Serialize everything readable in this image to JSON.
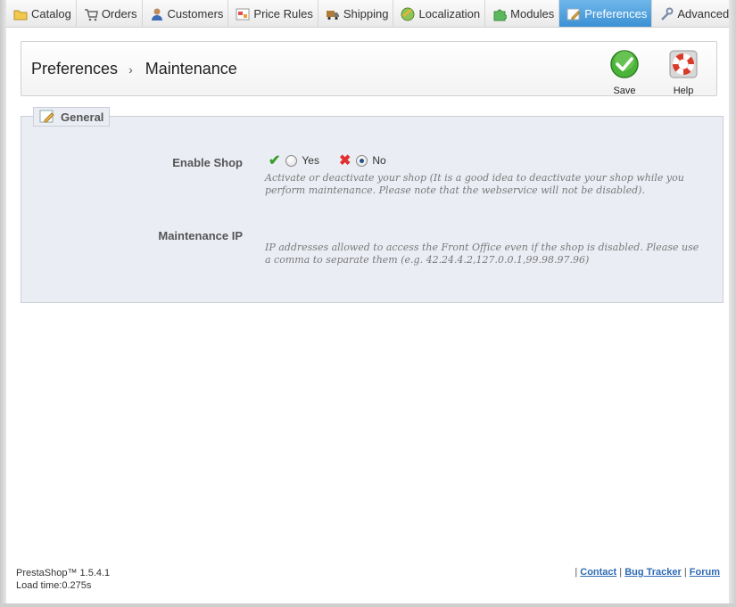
{
  "nav": {
    "tabs": [
      {
        "label": "Catalog",
        "icon": "folder-icon"
      },
      {
        "label": "Orders",
        "icon": "cart-icon"
      },
      {
        "label": "Customers",
        "icon": "user-icon"
      },
      {
        "label": "Price Rules",
        "icon": "price-tag-icon"
      },
      {
        "label": "Shipping",
        "icon": "truck-icon"
      },
      {
        "label": "Localization",
        "icon": "globe-icon"
      },
      {
        "label": "Modules",
        "icon": "puzzle-icon"
      },
      {
        "label": "Preferences",
        "icon": "preferences-icon",
        "active": true
      },
      {
        "label": "Advanced Paramete",
        "icon": "wrench-icon"
      }
    ]
  },
  "header": {
    "breadcrumb_parent": "Preferences",
    "breadcrumb_separator": "›",
    "breadcrumb_current": "Maintenance",
    "save_label": "Save",
    "help_label": "Help"
  },
  "form": {
    "legend": "General",
    "enable_shop": {
      "label": "Enable Shop",
      "yes_label": "Yes",
      "no_label": "No",
      "selected": "No",
      "hint": "Activate or deactivate your shop (It is a good idea to deactivate your shop while you perform maintenance. Please note that the webservice will not be disabled)."
    },
    "maintenance_ip": {
      "label": "Maintenance IP",
      "hint": "IP addresses allowed to access the Front Office even if the shop is disabled. Please use a comma to separate them (e.g. 42.24.4.2,127.0.0.1,99.98.97.96)"
    }
  },
  "footer": {
    "version": "PrestaShop™ 1.5.4.1",
    "load_time": "Load time:0.275s",
    "sep": "|",
    "links": {
      "contact": "Contact",
      "bug_tracker": "Bug Tracker",
      "forum": "Forum"
    }
  },
  "colors": {
    "active_tab": "#3a8fd2",
    "panel_bg": "#ebedf4",
    "link": "#2e6bb4",
    "save_green": "#3a9e2a",
    "help_red": "#d93a2a"
  }
}
